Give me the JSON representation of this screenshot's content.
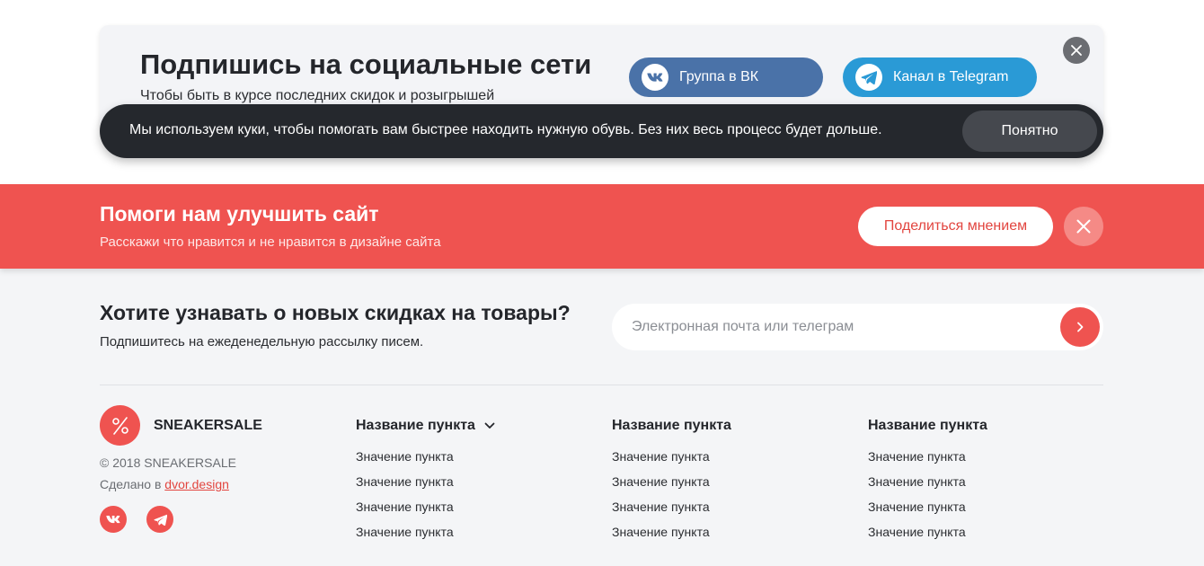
{
  "social": {
    "title": "Подпишись на социальные сети",
    "subtitle": "Чтобы быть в курсе последних скидок и розыгрышей",
    "vk_label": "Группа в ВК",
    "tg_label": "Канал в Telegram"
  },
  "cookie": {
    "text": "Мы используем куки, чтобы помогать вам быстрее находить нужную обувь. Без них весь процесс будет дольше.",
    "button": "Понятно"
  },
  "feedback": {
    "title": "Помоги нам улучшить сайт",
    "subtitle": "Расскажи что нравится и не нравится в дизайне сайта",
    "button": "Поделиться мнением"
  },
  "subscribe": {
    "title": "Хотите узнавать о новых скидках на товары?",
    "text": "Подпишитесь на ежеденедельную рассылку писем.",
    "placeholder": "Электронная почта или телеграм"
  },
  "footer": {
    "brand": "SNEAKERSALE",
    "copyright": "© 2018 SNEAKERSALE",
    "made_prefix": "Сделано в",
    "made_link": "dvor.design",
    "columns": [
      {
        "title": "Название пункта",
        "items": [
          "Значение пункта",
          "Значение пункта",
          "Значение пункта",
          "Значение пункта"
        ]
      },
      {
        "title": "Название пункта",
        "items": [
          "Значение пункта",
          "Значение пункта",
          "Значение пункта",
          "Значение пункта"
        ]
      },
      {
        "title": "Название пункта",
        "items": [
          "Значение пункта",
          "Значение пункта",
          "Значение пункта",
          "Значение пункта"
        ]
      }
    ]
  },
  "icons": {
    "vk": "vk-icon",
    "telegram": "telegram-icon",
    "close": "close-icon",
    "chevron_right": "chevron-right-icon",
    "chevron_down": "chevron-down-icon",
    "logo": "percent-logo-icon"
  },
  "colors": {
    "accent_red": "#ef5350",
    "vk_blue": "#4a72a8",
    "telegram_blue": "#2a9ad6",
    "cookie_dark": "#25282d"
  }
}
